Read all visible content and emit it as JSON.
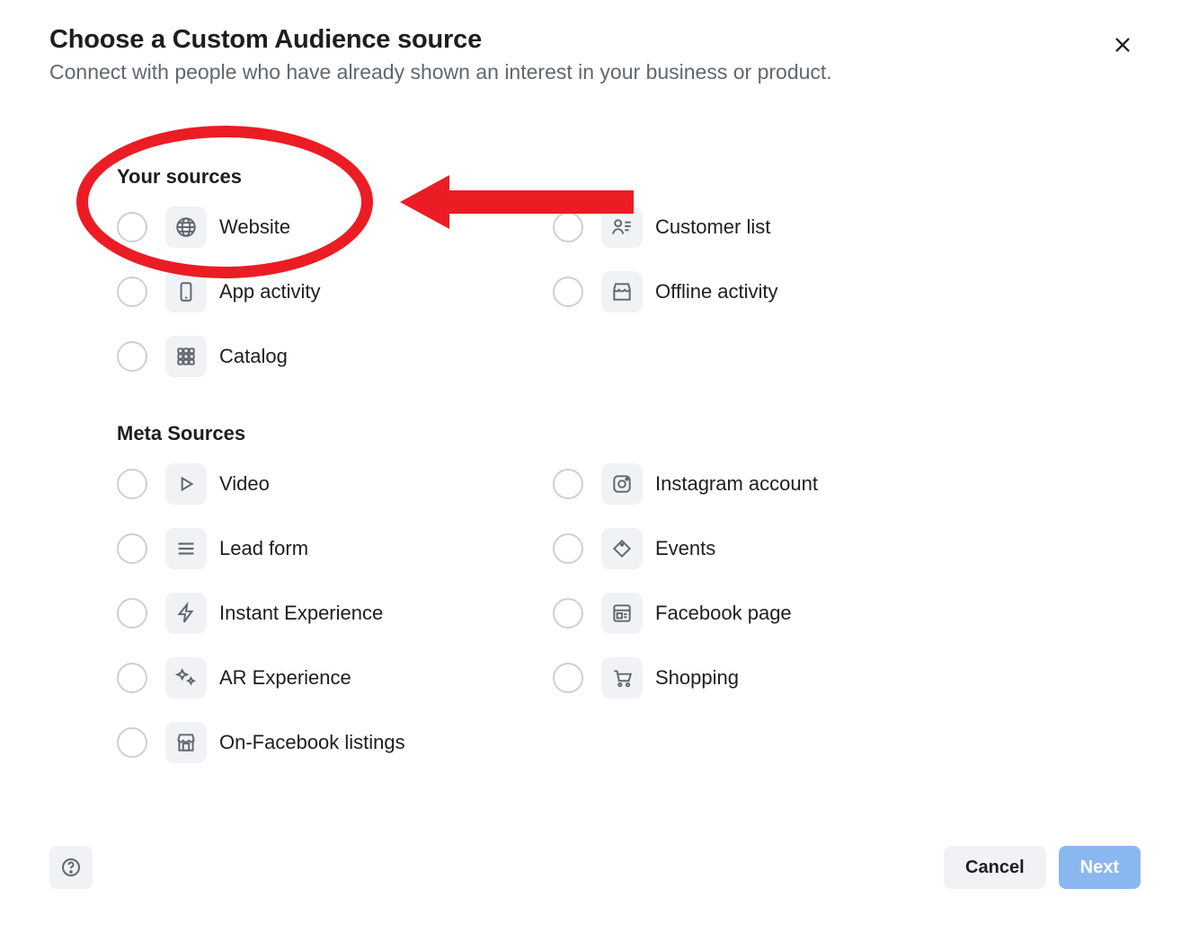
{
  "header": {
    "title": "Choose a Custom Audience source",
    "subtitle": "Connect with people who have already shown an interest in your business or product."
  },
  "sections": {
    "your_sources": {
      "heading": "Your sources",
      "options": {
        "website": "Website",
        "customer_list": "Customer list",
        "app_activity": "App activity",
        "offline_activity": "Offline activity",
        "catalog": "Catalog"
      }
    },
    "meta_sources": {
      "heading": "Meta Sources",
      "options": {
        "video": "Video",
        "instagram_account": "Instagram account",
        "lead_form": "Lead form",
        "events": "Events",
        "instant_experience": "Instant Experience",
        "facebook_page": "Facebook page",
        "ar_experience": "AR Experience",
        "shopping": "Shopping",
        "on_facebook_listings": "On-Facebook listings"
      }
    }
  },
  "footer": {
    "cancel": "Cancel",
    "next": "Next"
  },
  "annotation": {
    "highlighted_option": "website",
    "shape": "ellipse-with-arrow",
    "color": "#ec1c24"
  }
}
